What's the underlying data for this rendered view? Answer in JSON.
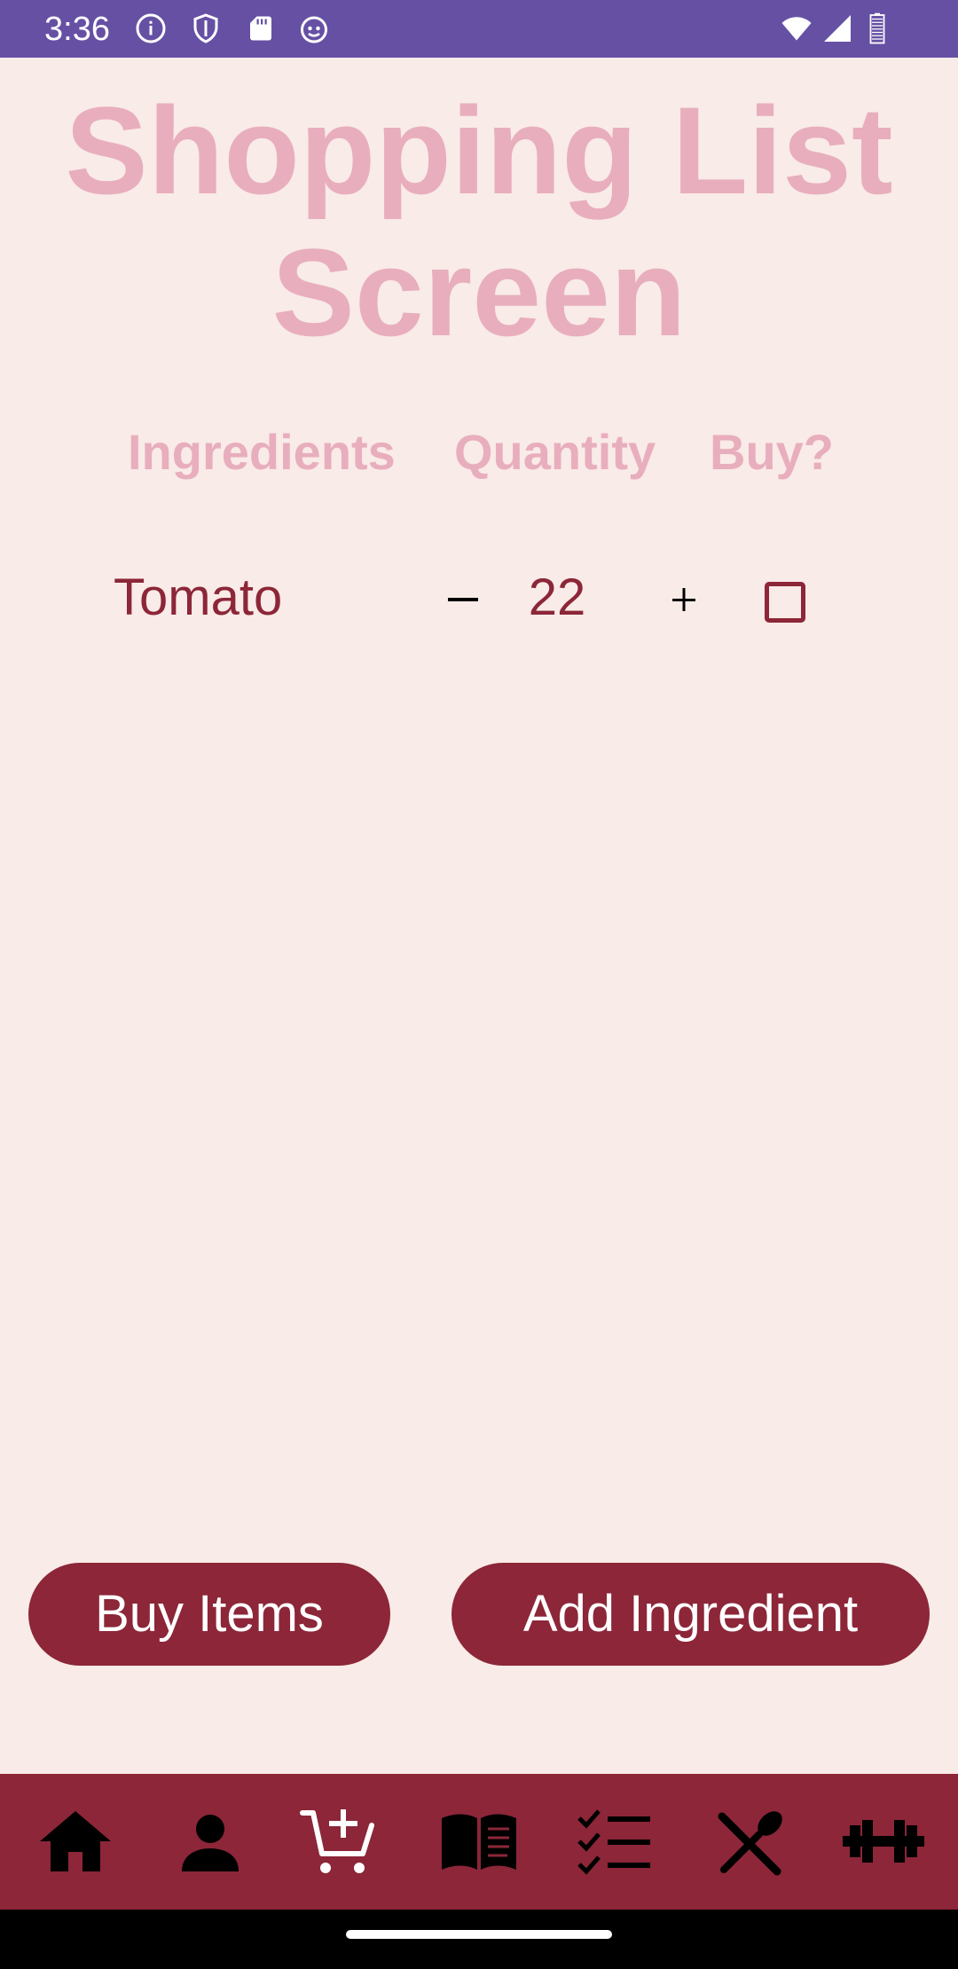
{
  "status_bar": {
    "time": "3:36",
    "background": "#6650a4",
    "left_icons": [
      "info-icon",
      "shield-icon",
      "sd-card-icon",
      "android-debug-icon"
    ],
    "right_icons": [
      "wifi-icon",
      "signal-icon",
      "battery-icon"
    ]
  },
  "screen": {
    "title": "Shopping List Screen"
  },
  "table": {
    "headers": {
      "ingredients": "Ingredients",
      "quantity": "Quantity",
      "buy": "Buy?"
    },
    "rows": [
      {
        "ingredient": "Tomato",
        "quantity": "22",
        "buy_checked": false,
        "decrement_label": "−",
        "increment_label": "+"
      }
    ]
  },
  "actions": {
    "buy_items": "Buy Items",
    "add_ingredient": "Add Ingredient"
  },
  "bottom_nav": {
    "items": [
      {
        "icon": "home-icon"
      },
      {
        "icon": "person-icon"
      },
      {
        "icon": "add-to-cart-icon"
      },
      {
        "icon": "book-icon"
      },
      {
        "icon": "checklist-icon"
      },
      {
        "icon": "dining-icon"
      },
      {
        "icon": "dumbbell-icon"
      }
    ]
  },
  "colors": {
    "background": "#f9ebe7",
    "accent": "#8c2638",
    "title": "#e8aebe",
    "status_bar": "#6650a4"
  }
}
